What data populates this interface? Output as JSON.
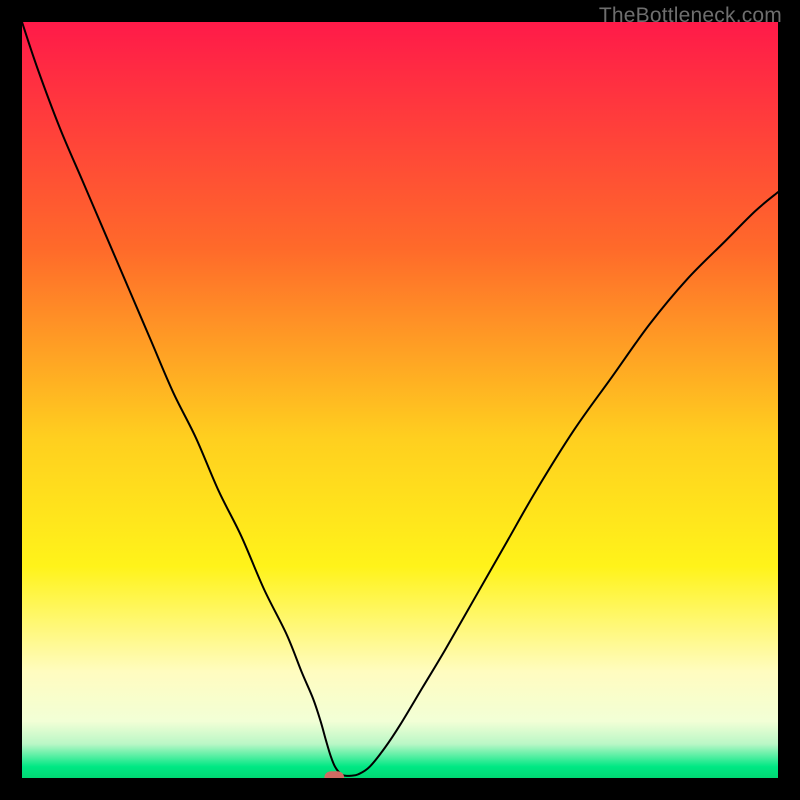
{
  "watermark": "TheBottleneck.com",
  "chart_data": {
    "type": "line",
    "title": "",
    "xlabel": "",
    "ylabel": "",
    "xlim": [
      0,
      100
    ],
    "ylim": [
      0,
      100
    ],
    "grid": false,
    "legend": false,
    "gradient_stops": [
      {
        "offset": 0.0,
        "color": "#ff1a49"
      },
      {
        "offset": 0.3,
        "color": "#ff6a2a"
      },
      {
        "offset": 0.55,
        "color": "#ffcf1f"
      },
      {
        "offset": 0.72,
        "color": "#fff31a"
      },
      {
        "offset": 0.86,
        "color": "#fffcc0"
      },
      {
        "offset": 0.925,
        "color": "#f2ffd6"
      },
      {
        "offset": 0.955,
        "color": "#baf7c6"
      },
      {
        "offset": 0.985,
        "color": "#00e884"
      },
      {
        "offset": 1.0,
        "color": "#00d873"
      }
    ],
    "marker": {
      "x": 41.3,
      "y": 0,
      "color": "#d06a63"
    },
    "series": [
      {
        "name": "bottleneck-curve",
        "color": "#000000",
        "x": [
          0,
          2,
          5,
          8,
          11,
          14,
          17,
          20,
          23,
          26,
          29,
          32,
          35,
          37,
          38.5,
          39.5,
          40.2,
          40.8,
          41.4,
          42.2,
          42.8,
          43.5,
          44.5,
          46,
          48,
          50,
          53,
          56,
          60,
          64,
          68,
          73,
          78,
          83,
          88,
          93,
          97,
          100
        ],
        "y": [
          100,
          94,
          86,
          79,
          72,
          65,
          58,
          51,
          45,
          38,
          32,
          25,
          19,
          14,
          10.5,
          7.5,
          5,
          3,
          1.5,
          0.5,
          0.3,
          0.3,
          0.5,
          1.5,
          4,
          7,
          12,
          17,
          24,
          31,
          38,
          46,
          53,
          60,
          66,
          71,
          75,
          77.5
        ]
      }
    ]
  }
}
